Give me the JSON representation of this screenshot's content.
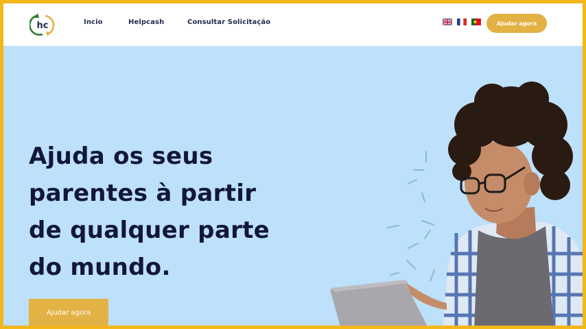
{
  "header": {
    "logo_text": "hc",
    "nav": [
      {
        "label": "Incio"
      },
      {
        "label": "Helpcash"
      },
      {
        "label": "Consultar Solicitação"
      }
    ],
    "languages": [
      {
        "icon": "uk-flag-icon"
      },
      {
        "icon": "france-flag-icon"
      },
      {
        "icon": "portugal-flag-icon"
      }
    ],
    "cta_label": "Ajudar agora"
  },
  "hero": {
    "title_lines": [
      "Ajuda os seus",
      "parentes à partir",
      "de qualquer parte",
      "do mundo."
    ],
    "cta_label": "Ajudar agora",
    "image": "young man with curly hair, glasses and plaid shirt holding a laptop"
  },
  "colors": {
    "frame": "#f4b71a",
    "hero_background": "#bde0fb",
    "accent": "#e3b244",
    "title": "#12163d",
    "nav_text": "#1f2a4a"
  }
}
